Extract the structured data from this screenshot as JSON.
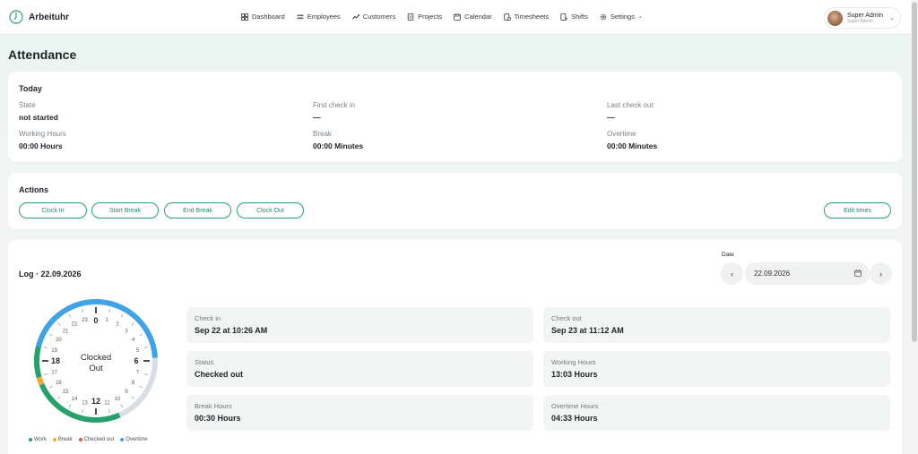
{
  "app": {
    "name": "Arbeituhr"
  },
  "nav": {
    "items": [
      {
        "label": "Dashboard",
        "icon": "dashboard-icon"
      },
      {
        "label": "Employees",
        "icon": "employees-icon"
      },
      {
        "label": "Customers",
        "icon": "customers-icon"
      },
      {
        "label": "Projects",
        "icon": "projects-icon"
      },
      {
        "label": "Calendar",
        "icon": "calendar-icon"
      },
      {
        "label": "Timesheets",
        "icon": "timesheets-icon"
      },
      {
        "label": "Shifts",
        "icon": "shifts-icon"
      },
      {
        "label": "Settings",
        "icon": "gear-icon"
      }
    ]
  },
  "user": {
    "name": "Super Admin",
    "role": "Super Admin"
  },
  "page": {
    "title": "Attendance"
  },
  "today": {
    "title": "Today",
    "state_label": "State",
    "state_value": "not started",
    "first_in_label": "First check in",
    "first_in_value": "—",
    "last_out_label": "Last check out",
    "last_out_value": "—",
    "working_label": "Working Hours",
    "working_value": "00:00 Hours",
    "break_label": "Break",
    "break_value": "00:00 Minutes",
    "overtime_label": "Overtime",
    "overtime_value": "00:00 Minutes"
  },
  "actions": {
    "title": "Actions",
    "clock_in": "Clock In",
    "start_break": "Start Break",
    "end_break": "End Break",
    "clock_out": "Clock Out",
    "edit_times": "Edit times"
  },
  "log": {
    "title": "Log · 22.09.2026",
    "date_label": "Date",
    "date_value": "22.09.2026",
    "clock": {
      "center_line1": "Clocked",
      "center_line2": "Out",
      "hours": [
        "0",
        "1",
        "2",
        "3",
        "4",
        "5",
        "6",
        "7",
        "8",
        "9",
        "10",
        "11",
        "12",
        "13",
        "14",
        "15",
        "16",
        "17",
        "18",
        "19",
        "20",
        "21",
        "22",
        "23"
      ],
      "work_color": "#27a16b",
      "break_color": "#f0a92e",
      "checked_out_color": "#e0574f",
      "overtime_color": "#3fa3e6",
      "track_color": "#d8dee3",
      "segments": [
        {
          "type": "overtime",
          "from": 0,
          "to": 5.8
        },
        {
          "type": "work",
          "from": 10.43,
          "to": 16.43
        },
        {
          "type": "break",
          "from": 16.43,
          "to": 16.93
        },
        {
          "type": "work",
          "from": 16.93,
          "to": 18.93
        },
        {
          "type": "overtime",
          "from": 18.93,
          "to": 24
        }
      ]
    },
    "legend": [
      {
        "label": "Work",
        "color": "#27a16b"
      },
      {
        "label": "Break",
        "color": "#f0a92e"
      },
      {
        "label": "Checked out",
        "color": "#e0574f"
      },
      {
        "label": "Overtime",
        "color": "#3fa3e6"
      }
    ],
    "stats": {
      "check_in_label": "Check in",
      "check_in_value": "Sep 22 at 10:26 AM",
      "check_out_label": "Check out",
      "check_out_value": "Sep 23 at 11:12 AM",
      "status_label": "Status",
      "status_value": "Checked out",
      "working_label": "Working Hours",
      "working_value": "13:03 Hours",
      "break_label": "Break Hours",
      "break_value": "00:30 Hours",
      "overtime_label": "Overtime Hours",
      "overtime_value": "04:33 Hours"
    }
  }
}
